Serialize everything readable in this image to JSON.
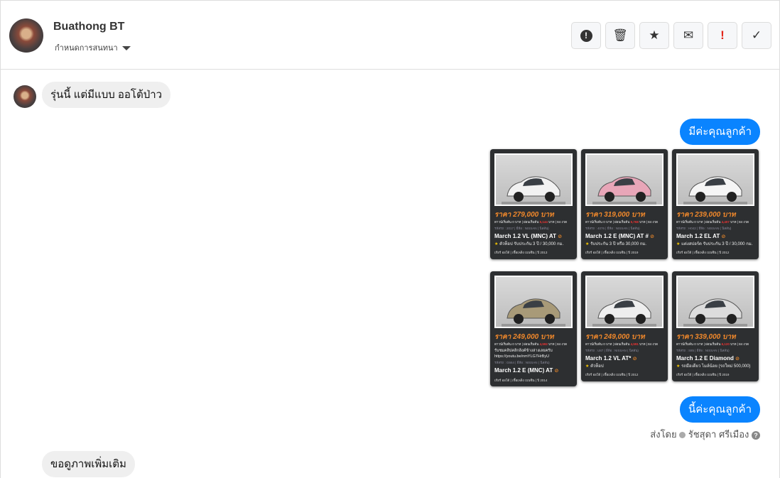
{
  "header": {
    "contact_name": "Buathong BT",
    "conversation_settings": "กำหนดการสนทนา",
    "actions": [
      {
        "id": "alert",
        "icon": "alert-circle-icon",
        "glyph": "!"
      },
      {
        "id": "delete",
        "icon": "trash-icon",
        "glyph": "🗑"
      },
      {
        "id": "star",
        "icon": "star-icon",
        "glyph": "★"
      },
      {
        "id": "mail",
        "icon": "envelope-icon",
        "glyph": "✉"
      },
      {
        "id": "important",
        "icon": "exclamation-icon",
        "glyph": "!"
      },
      {
        "id": "done",
        "icon": "check-icon",
        "glyph": "✓"
      }
    ]
  },
  "messages": {
    "m1": "รุ่นนี้ แต่มีแบบ ออโต้ป่าว",
    "m2": "มีค่ะคุณลูกค้า",
    "m3": "นี้ค่ะคุณลูกค้า",
    "sent_by_label": "ส่งโดย",
    "sent_by_name": "รัชสุดา ศรีเมือง",
    "m4": "ขอดูภาพเพิ่มเติม"
  },
  "cars": [
    {
      "price": "ราคา 279,000 บาท",
      "pay_a": "ดาวน์เริ่มต้น 0 บาท | ผ่อนเริ่มต้น ",
      "pay_amt": "5,144",
      "pay_b": " บาท | 84 งวด",
      "tags": "รหัสรถ : 2017 | ยี่ห้อ : NISSAN ( นิสสัน)",
      "title": "March 1.2 VL (MNC) AT",
      "note": "ตัวท็อป รับประกัน 3 ปี / 30,000 กม.",
      "foot": "เกียร์ ออโต้  |  เชื้อเพลิง เบนซิน  |  ปี 2013",
      "color": "#f2f2f2"
    },
    {
      "price": "ราคา 319,000 บาท",
      "pay_a": "ดาวน์เริ่มต้น 0 บาท | ผ่อนเริ่มต้น ",
      "pay_amt": "5,768",
      "pay_b": " บาท | 84 งวด",
      "tags": "รหัสรถ : 4076 | ยี่ห้อ : NISSAN ( นิสสัน)",
      "title": "March 1.2 E (MNC) AT #",
      "note": "รับประกัน 3 ปี หรือ 30,000 กม.",
      "foot": "เกียร์ ออโต้  |  เชื้อเพลิง เบนซิน  |  ปี 2019",
      "color": "#e8a6b8"
    },
    {
      "price": "ราคา 239,000 บาท",
      "pay_a": "ดาวน์เริ่มต้น 0 บาท | ผ่อนเริ่มต้น ",
      "pay_amt": "4,407",
      "pay_b": " บาท | 84 งวด",
      "tags": "รหัสรถ : H042 | ยี่ห้อ : NISSAN ( นิสสัน)",
      "title": "March 1.2 EL AT",
      "note": "แต่งสปอร์ต รับประกัน 3 ปี / 30,000 กม.",
      "foot": "เกียร์ ออโต้  |  เชื้อเพลิง เบนซิน  |  ปี 2012",
      "color": "#f5f5f5"
    },
    {
      "price": "ราคา 249,000 บาท",
      "pay_a": "ดาวน์เริ่มต้น 0 บาท | ผ่อนเริ่มต้น ",
      "pay_amt": "4,592",
      "pay_b": " บาท | 84 งวด",
      "tags": "รหัสรถ : G664 | ยี่ห้อ : NISSAN ( นิสสัน)",
      "extra": "รับชมคลิปคลิกลิงค์ข้างล่างเลยครับ https://youtu.be/nmYLG7HrByU",
      "title": "March 1.2 E (MNC) AT",
      "note": "",
      "foot": "เกียร์ ออโต้  |  เชื้อเพลิง เบนซิน  |  ปี 2014",
      "color": "#a89a78"
    },
    {
      "price": "ราคา 249,000 บาท",
      "pay_a": "ดาวน์เริ่มต้น 0 บาท | ผ่อนเริ่มต้น ",
      "pay_amt": "4,591",
      "pay_b": " บาท | 84 งวด",
      "tags": "รหัสรถ : U87 | ยี่ห้อ : NISSAN ( นิสสัน)",
      "title": "March 1.2 VL AT*",
      "note": "ตัวท็อป",
      "foot": "เกียร์ ออโต้  |  เชื้อเพลิง เบนซิน  |  ปี 2012",
      "color": "#eeeeee"
    },
    {
      "price": "ราคา 339,000 บาท",
      "pay_a": "ดาวน์เริ่มต้น 0 บาท | ผ่อนเริ่มต้น ",
      "pay_amt": "6,120",
      "pay_b": " บาท | 84 งวด",
      "tags": "รหัสรถ : S85 | ยี่ห้อ : NISSAN ( นิสสัน)",
      "title": "March 1.2 E Diamond",
      "note": "รถมือเดียว ไมล์น้อย (รถใหม่ 500,000)",
      "foot": "เกียร์ ออโต้  |  เชื้อเพลิง เบนซิน  |  ปี 2019",
      "color": "#dcdcdc"
    }
  ]
}
